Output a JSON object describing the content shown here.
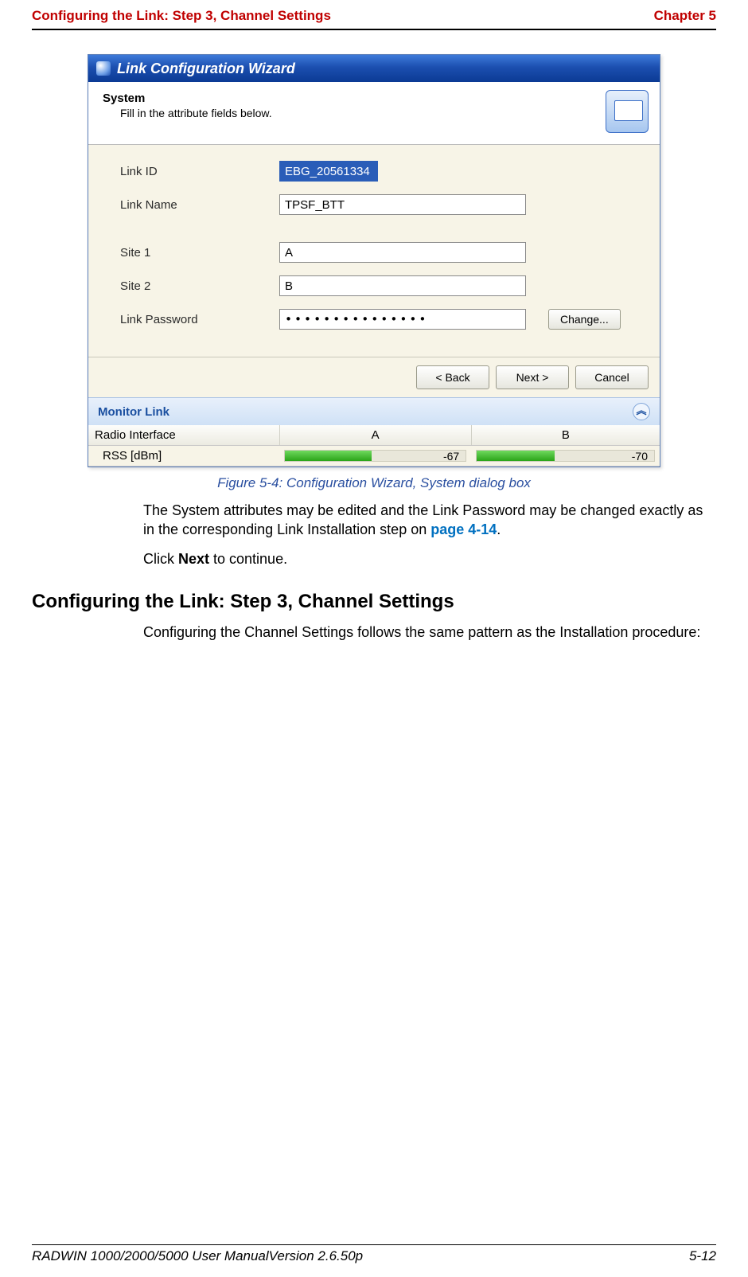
{
  "header": {
    "left": "Configuring the Link: Step 3, Channel Settings",
    "right": "Chapter 5"
  },
  "wizard": {
    "title": "Link Configuration Wizard",
    "section_title": "System",
    "section_sub": "Fill in the attribute fields below.",
    "fields": {
      "link_id_label": "Link ID",
      "link_id_value": "EBG_20561334",
      "link_name_label": "Link Name",
      "link_name_value": "TPSF_BTT",
      "site1_label": "Site 1",
      "site1_value": "A",
      "site2_label": "Site 2",
      "site2_value": "B",
      "link_password_label": "Link Password",
      "link_password_value": "•••••••••••••••",
      "change_btn": "Change..."
    },
    "buttons": {
      "back": "< Back",
      "next": "Next >",
      "cancel": "Cancel"
    },
    "monitor": {
      "label": "Monitor Link",
      "radio_interface": "Radio Interface",
      "col_a": "A",
      "col_b": "B",
      "rss_label": "RSS [dBm]",
      "rss_a": "-67",
      "rss_b": "-70"
    }
  },
  "caption": "Figure 5-4: Configuration Wizard, System dialog box",
  "body": {
    "p1a": "The System attributes may be edited and the Link Password may be changed exactly as in the corresponding Link Installation step on ",
    "p1link": "page 4-14",
    "p1b": ".",
    "p2a": "Click ",
    "p2bold": "Next",
    "p2b": " to continue."
  },
  "section_heading": "Configuring the Link: Step 3, Channel Settings",
  "body2": "Configuring the Channel Settings follows the same pattern as the Installation procedure:",
  "footer": {
    "left": "RADWIN 1000/2000/5000 User ManualVersion  2.6.50p",
    "right": "5-12"
  }
}
